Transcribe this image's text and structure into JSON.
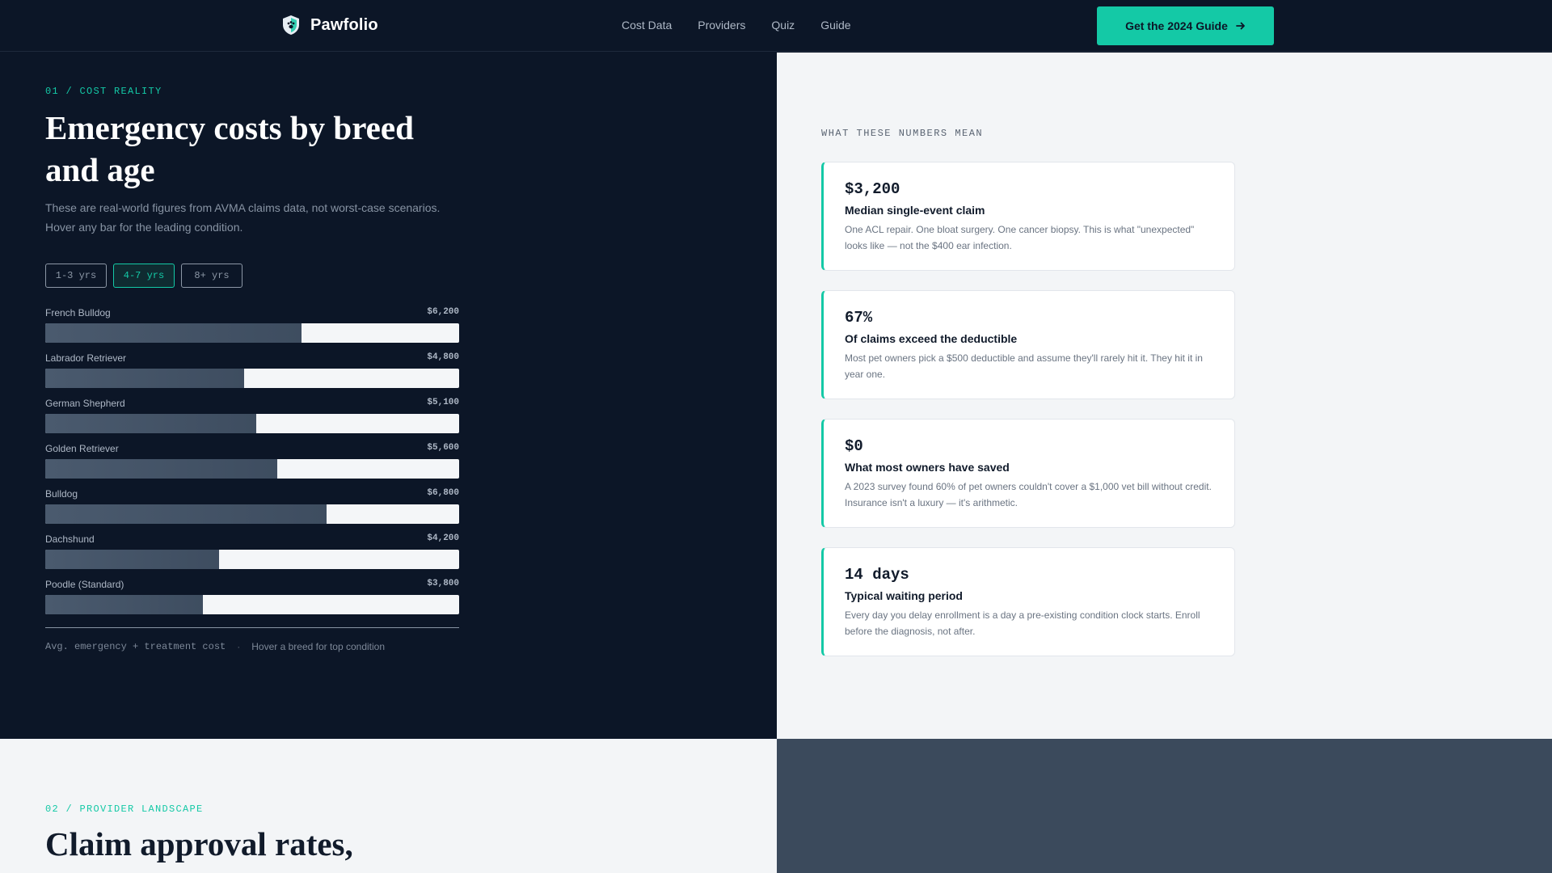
{
  "brand": {
    "name": "Pawfolio",
    "icon": "shield-paw-icon"
  },
  "nav": {
    "items": [
      "Cost Data",
      "Providers",
      "Quiz",
      "Guide"
    ]
  },
  "cta": {
    "label": "Get the 2024 Guide",
    "icon": "arrow-right-icon"
  },
  "colors": {
    "accent": "#14c9a6",
    "navy": "#0c1627",
    "light": "#f3f5f7",
    "slate": "#3b4a5c"
  },
  "section1": {
    "eyebrow": "01 / COST REALITY",
    "heading": "Emergency costs by breed and age",
    "subtext": "These are real-world figures from AVMA claims data, not worst-case scenarios. Hover any bar for the leading condition.",
    "tabs": [
      {
        "label": "1-3 yrs",
        "active": false
      },
      {
        "label": "4-7 yrs",
        "active": true
      },
      {
        "label": "8+ yrs",
        "active": false
      }
    ],
    "footer_metric": "Avg. emergency + treatment cost",
    "footer_separator": "·",
    "footer_hint": "Hover a breed for top condition"
  },
  "chart_data": {
    "type": "bar",
    "orientation": "horizontal",
    "categories": [
      "French Bulldog",
      "Labrador Retriever",
      "German Shepherd",
      "Golden Retriever",
      "Bulldog",
      "Dachshund",
      "Poodle (Standard)"
    ],
    "values": [
      6200,
      4800,
      5100,
      5600,
      6800,
      4200,
      3800
    ],
    "value_labels": [
      "$6,200",
      "$4,800",
      "$5,100",
      "$5,600",
      "$6,800",
      "$4,200",
      "$3,800"
    ],
    "xlim": [
      0,
      10000
    ],
    "grid": false
  },
  "insights": {
    "eyebrow": "WHAT THESE NUMBERS MEAN",
    "cards": [
      {
        "value": "$3,200",
        "title": "Median single-event claim",
        "desc": "One ACL repair. One bloat surgery. One cancer biopsy. This is what \"unexpected\" looks like — not the $400 ear infection."
      },
      {
        "value": "67%",
        "title": "Of claims exceed the deductible",
        "desc": "Most pet owners pick a $500 deductible and assume they'll rarely hit it. They hit it in year one."
      },
      {
        "value": "$0",
        "title": "What most owners have saved",
        "desc": "A 2023 survey found 60% of pet owners couldn't cover a $1,000 vet bill without credit. Insurance isn't a luxury — it's arithmetic."
      },
      {
        "value": "14 days",
        "title": "Typical waiting period",
        "desc": "Every day you delay enrollment is a day a pre-existing condition clock starts. Enroll before the diagnosis, not after."
      }
    ]
  },
  "section2": {
    "eyebrow": "02 / PROVIDER LANDSCAPE",
    "heading": "Claim approval rates,"
  }
}
